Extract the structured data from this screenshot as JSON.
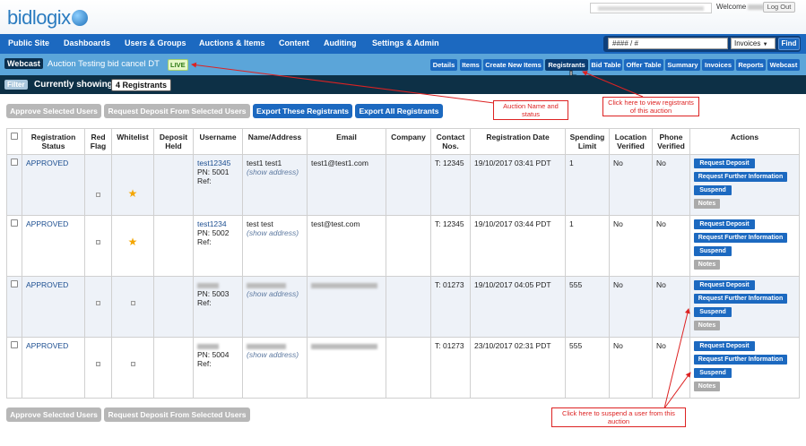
{
  "header": {
    "logo": "bidlogix",
    "welcome_label": "Welcome",
    "logout_label": "Log Out"
  },
  "nav": {
    "items": [
      "Public Site",
      "Dashboards",
      "Users & Groups",
      "Auctions & Items",
      "Content",
      "Auditing",
      "Settings & Admin"
    ],
    "search_placeholder": "#### / #",
    "search_type": "Invoices",
    "find_label": "Find"
  },
  "auction": {
    "type": "Webcast",
    "name": "Auction Testing bid cancel DT",
    "status": "LIVE",
    "tabs": [
      "Details",
      "Items",
      "Create New Items",
      "Registrants",
      "Bid Table",
      "Offer Table",
      "Summary",
      "Invoices",
      "Reports",
      "Webcast"
    ],
    "active_tab": "Registrants"
  },
  "filter": {
    "filter_label": "Filter",
    "currently_label": "Currently showing",
    "count_label": "4 Registrants"
  },
  "actions": {
    "approve": "Approve Selected Users",
    "request_deposit": "Request Deposit From Selected Users",
    "export_these": "Export These Registrants",
    "export_all": "Export All Registrants"
  },
  "table": {
    "headers": [
      "",
      "Registration Status",
      "Red Flag",
      "Whitelist",
      "Deposit Held",
      "Username",
      "Name/Address",
      "Email",
      "Company",
      "Contact Nos.",
      "Registration Date",
      "Spending Limit",
      "Location Verified",
      "Phone Verified",
      "Actions"
    ],
    "show_address": "(show address)",
    "action_labels": {
      "request_deposit": "Request Deposit",
      "request_info": "Request Further Information",
      "suspend": "Suspend",
      "notes": "Notes"
    },
    "rows": [
      {
        "status": "APPROVED",
        "whitelist": true,
        "username": "test12345",
        "pn": "PN: 5001",
        "ref": "Ref:",
        "name": "test1 test1",
        "email": "test1@test1.com",
        "contact": "T: 12345",
        "date": "19/10/2017 03:41 PDT",
        "limit": "1",
        "location": "No",
        "phone": "No"
      },
      {
        "status": "APPROVED",
        "whitelist": true,
        "username": "test1234",
        "pn": "PN: 5002",
        "ref": "Ref:",
        "name": "test test",
        "email": "test@test.com",
        "contact": "T: 12345",
        "date": "19/10/2017 03:44 PDT",
        "limit": "1",
        "location": "No",
        "phone": "No"
      },
      {
        "status": "APPROVED",
        "whitelist": false,
        "username": "",
        "pn": "PN: 5003",
        "ref": "Ref:",
        "name": "",
        "email": "",
        "contact": "T: 01273",
        "date": "19/10/2017 04:05 PDT",
        "limit": "555",
        "location": "No",
        "phone": "No"
      },
      {
        "status": "APPROVED",
        "whitelist": false,
        "username": "",
        "pn": "PN: 5004",
        "ref": "Ref:",
        "name": "",
        "email": "",
        "contact": "T: 01273",
        "date": "23/10/2017 02:31 PDT",
        "limit": "555",
        "location": "No",
        "phone": "No"
      }
    ]
  },
  "annotations": {
    "auction_name": "Auction Name and status",
    "registrants": "Click here to view registrants of this auction",
    "suspend": "Click here to suspend a user from this auction"
  },
  "colors": {
    "nav_blue": "#1c69c0",
    "auction_bar": "#5ba5d9",
    "filter_bar": "#0d3046",
    "annotation_red": "#d22"
  }
}
